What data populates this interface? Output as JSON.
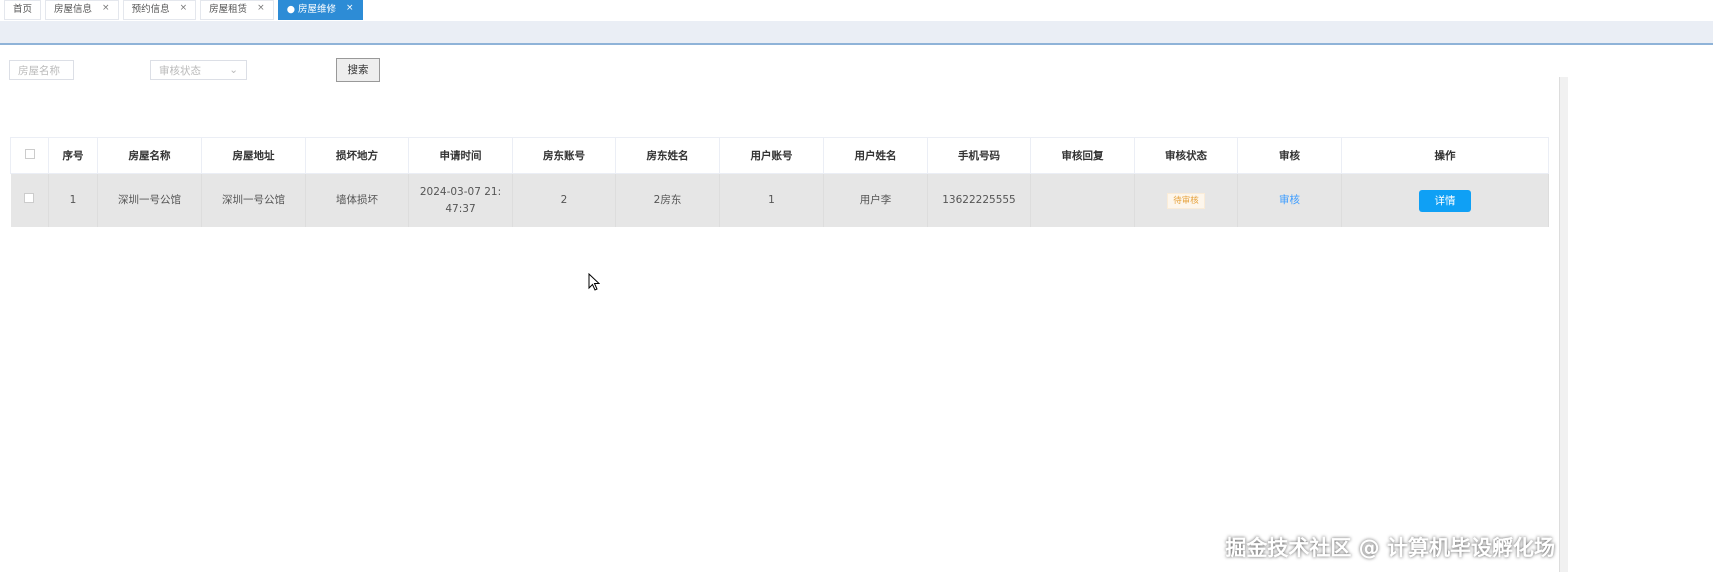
{
  "tabs": [
    {
      "label": "首页",
      "closable": false
    },
    {
      "label": "房屋信息",
      "closable": true
    },
    {
      "label": "预约信息",
      "closable": true
    },
    {
      "label": "房屋租赁",
      "closable": true
    },
    {
      "label": "● 房屋维修",
      "closable": true,
      "active": true
    }
  ],
  "close_glyph": "×",
  "search": {
    "name_placeholder": "房屋名称",
    "status_placeholder": "审核状态",
    "search_label": "搜索"
  },
  "table": {
    "headers": [
      "序号",
      "房屋名称",
      "房屋地址",
      "损坏地方",
      "申请时间",
      "房东账号",
      "房东姓名",
      "用户账号",
      "用户姓名",
      "手机号码",
      "审核回复",
      "审核状态",
      "审核",
      "操作"
    ],
    "rows": [
      {
        "index": "1",
        "house_name": "深圳一号公馆",
        "house_address": "深圳一号公馆",
        "damage": "墙体损坏",
        "time": "2024-03-07 21:47:37",
        "landlord_account": "2",
        "landlord_name": "2房东",
        "user_account": "1",
        "user_name": "用户李",
        "phone": "13622225555",
        "reply": "",
        "status": "待审核",
        "review_link": "审核",
        "detail_label": "详情"
      }
    ]
  },
  "watermark": "掘金技术社区 @ 计算机毕设孵化场"
}
